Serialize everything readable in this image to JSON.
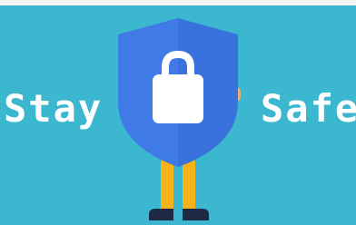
{
  "scene": {
    "background_color": "#3BB7CF",
    "shield_color": "#3F7AE6",
    "shield_inner_color": "#2F64CC",
    "lock_color": "#FFFFFF",
    "legs_color": "#F5B319",
    "shoes_color": "#1E2A44",
    "hands_color": "#E7B07C"
  },
  "text": {
    "left_word": "Stay",
    "right_word": "Safe"
  }
}
